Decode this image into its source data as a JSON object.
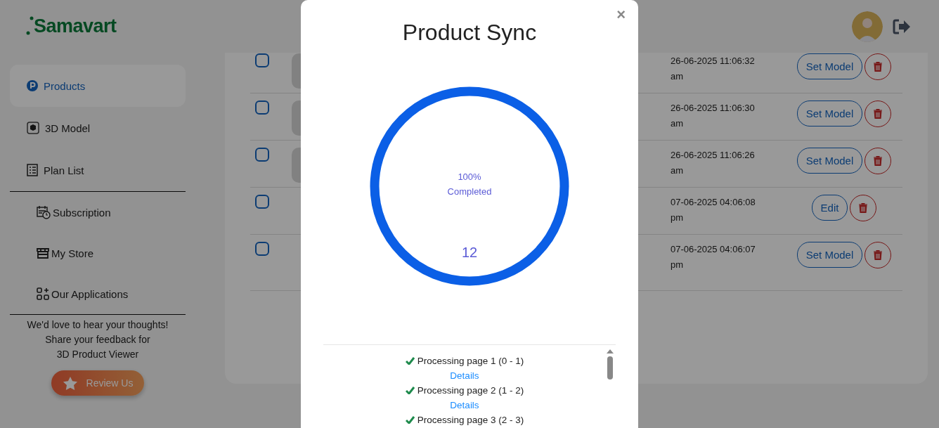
{
  "header": {
    "logo": "Samavart"
  },
  "sidebar": {
    "items": [
      {
        "label": "Products",
        "selected": true
      },
      {
        "label": "3D Model",
        "selected": false
      },
      {
        "label": "Plan List",
        "selected": false
      }
    ],
    "more_items": [
      {
        "label": "Subscription"
      },
      {
        "label": "My Store"
      },
      {
        "label": "Our Applications"
      }
    ],
    "feedback": [
      "We'd love to hear your thoughts!",
      "Share your feedback for",
      "3D Product Viewer"
    ],
    "review_button": "Review Us"
  },
  "products": {
    "rows": [
      {
        "checked": false,
        "thumbnail": true,
        "date": "26-06-2025 11:06:32",
        "ampm": "am",
        "action": "Set Model"
      },
      {
        "checked": false,
        "thumbnail": true,
        "date": "26-06-2025 11:06:30",
        "ampm": "am",
        "action": "Set Model"
      },
      {
        "checked": false,
        "thumbnail": true,
        "date": "26-06-2025 11:06:26",
        "ampm": "am",
        "action": "Set Model"
      },
      {
        "checked": false,
        "thumbnail": false,
        "date": "07-06-2025 04:06:08",
        "ampm": "pm",
        "action": "Edit"
      },
      {
        "checked": false,
        "thumbnail": false,
        "date": "07-06-2025 04:06:07",
        "ampm": "pm",
        "action": "Set Model"
      }
    ]
  },
  "modal": {
    "title": "Product Sync",
    "close": "×",
    "progress": {
      "level": 1,
      "percent": "100%",
      "status": "Completed",
      "count": "12"
    },
    "log": [
      {
        "text": "Processing page 1 (0 - 1)",
        "done": true,
        "link": "Details"
      },
      {
        "text": "Processing page 2 (1 - 2)",
        "done": true,
        "link": "Details"
      },
      {
        "text": "Processing page 3 (2 - 3)",
        "done": true
      }
    ]
  }
}
